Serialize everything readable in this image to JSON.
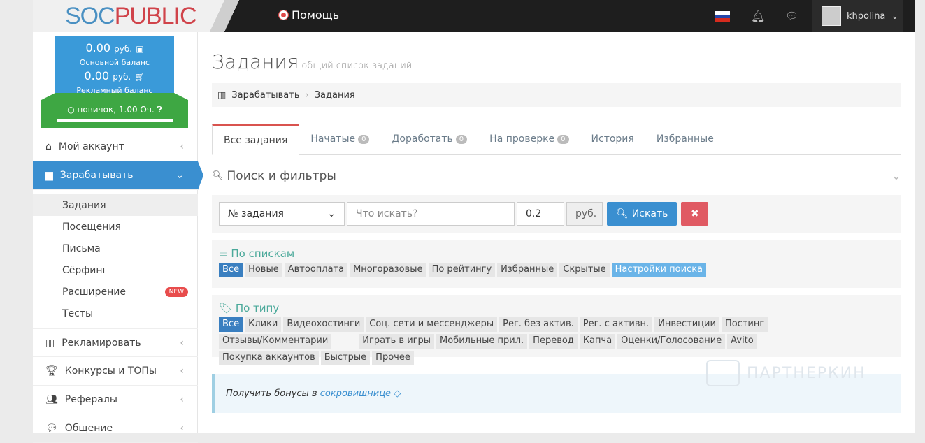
{
  "header": {
    "logo_a": "SOC",
    "logo_b": "PUBLIC",
    "help": "Помощь",
    "username": "khpolina"
  },
  "balance": {
    "main_amount": "0.00",
    "currency": "руб.",
    "main_label": "Основной баланс",
    "ad_amount": "0.00",
    "ad_label": "Рекламный баланс",
    "rank": "новичок, 1.00 Оч."
  },
  "sidebar": {
    "items": [
      {
        "label": "Мой аккаунт",
        "icon": "home-icon"
      },
      {
        "label": "Зарабатывать",
        "icon": "briefcase-icon"
      },
      {
        "label": "Рекламировать",
        "icon": "bar-chart-icon"
      },
      {
        "label": "Конкурсы и ТОПы",
        "icon": "trophy-icon"
      },
      {
        "label": "Рефералы",
        "icon": "users-icon"
      },
      {
        "label": "Общение",
        "icon": "comments-icon"
      }
    ],
    "sub": [
      "Задания",
      "Посещения",
      "Письма",
      "Сёрфинг",
      "Расширение",
      "Тесты"
    ],
    "new_badge": "NEW"
  },
  "page": {
    "title": "Задания",
    "subtitle": "общий список заданий",
    "breadcrumb": [
      "Зарабатывать",
      "Задания"
    ]
  },
  "tabs": [
    {
      "label": "Все задания"
    },
    {
      "label": "Начатые",
      "count": "0"
    },
    {
      "label": "Доработать",
      "count": "0"
    },
    {
      "label": "На проверке",
      "count": "0"
    },
    {
      "label": "История"
    },
    {
      "label": "Избранные"
    }
  ],
  "search": {
    "title": "Поиск и фильтры",
    "select": "№ задания",
    "placeholder": "Что искать?",
    "price": "0.2",
    "currency": "руб.",
    "button": "Искать"
  },
  "lists": {
    "title": "По спискам",
    "chips": [
      "Все",
      "Новые",
      "Автооплата",
      "Многоразовые",
      "По рейтингу",
      "Избранные",
      "Скрытые"
    ],
    "settings": "Настройки поиска"
  },
  "types": {
    "title": "По типу",
    "chips": [
      "Все",
      "Клики",
      "Видеохостинги",
      "Соц. сети и мессенджеры",
      "Рег. без актив.",
      "Рег. с активн.",
      "Инвестиции",
      "Постинг",
      "Отзывы/Комментарии",
      "Играть в игры",
      "Мобильные прил.",
      "Перевод",
      "Капча",
      "Оценки/Голосование",
      "Avito",
      "Покупка аккаунтов",
      "Быстрые",
      "Прочее"
    ]
  },
  "info": {
    "text": "Получить бонусы в ",
    "link": "сокровищнице"
  },
  "watermark": "ПАРТНЕРКИН"
}
